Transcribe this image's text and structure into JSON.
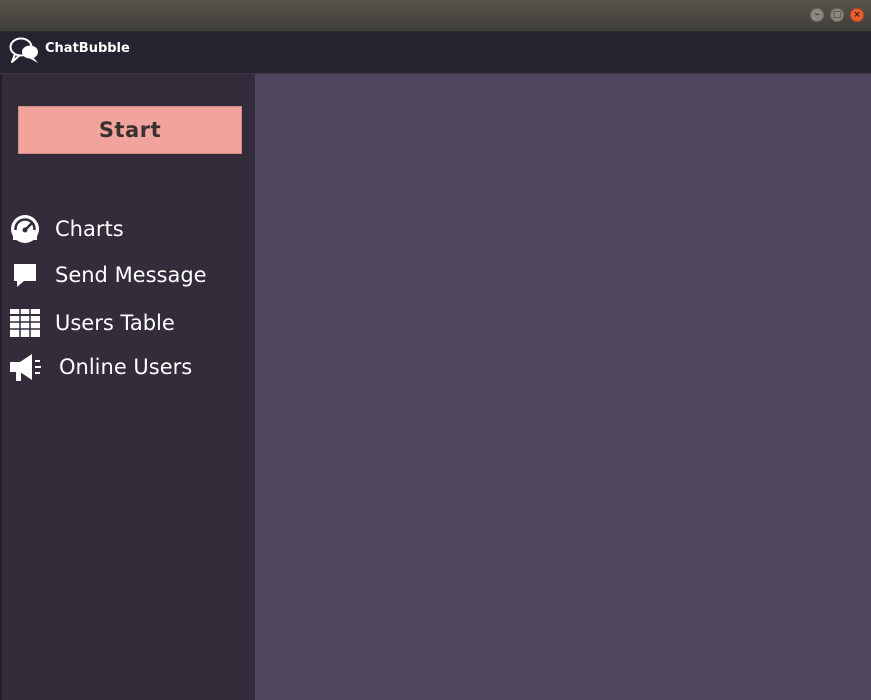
{
  "window": {
    "title": "",
    "controls": {
      "minimize_glyph": "–",
      "maximize_glyph": "□",
      "close_glyph": "×"
    }
  },
  "header": {
    "brand": "ChatBubble",
    "logo_icon": "chat-bubbles-icon"
  },
  "sidebar": {
    "start_label": "Start",
    "start_color": "#f0a49c",
    "items": [
      {
        "label": "Charts",
        "icon": "gauge-icon"
      },
      {
        "label": "Send Message",
        "icon": "message-icon"
      },
      {
        "label": "Users Table",
        "icon": "table-icon"
      },
      {
        "label": "Online Users",
        "icon": "megaphone-icon"
      }
    ]
  },
  "colors": {
    "sidebar_bg": "#332c3b",
    "content_bg": "#51475f",
    "header_bg": "#262331"
  }
}
